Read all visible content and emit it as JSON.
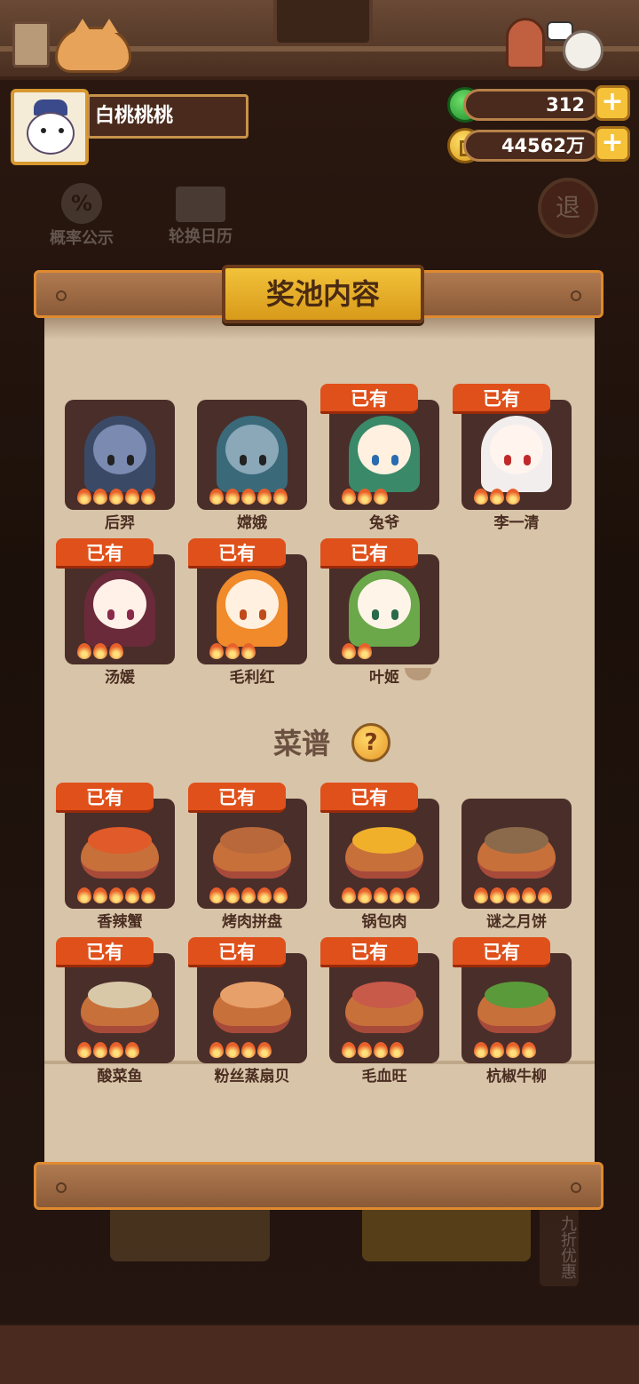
{
  "user": {
    "name": "白桃桃桃"
  },
  "currency": {
    "gems": "312",
    "coins": "44562万"
  },
  "bg_buttons": {
    "probability": "概率公示",
    "calendar": "轮换日历",
    "exit": "退",
    "discount": "九折优惠"
  },
  "panel": {
    "title": "奖池内容"
  },
  "characters": [
    {
      "name": "后羿",
      "owned": false,
      "stars": 5,
      "hair": "#3a4a66",
      "skin": "#7a8ab0",
      "eye": "#222"
    },
    {
      "name": "嫦娥",
      "owned": false,
      "stars": 5,
      "hair": "#3a6a7a",
      "skin": "#8aa8b8",
      "eye": "#222"
    },
    {
      "name": "兔爷",
      "owned": true,
      "stars": 3,
      "hair": "#3a8a6a",
      "skin": "#fff0e0",
      "eye": "#2a6ab0"
    },
    {
      "name": "李一清",
      "owned": true,
      "stars": 3,
      "hair": "#f2eeee",
      "skin": "#fff4ee",
      "eye": "#c02a2a"
    },
    {
      "name": "汤媛",
      "owned": true,
      "stars": 3,
      "hair": "#6a2a3a",
      "skin": "#fff0e8",
      "eye": "#8a2a4a"
    },
    {
      "name": "毛利红",
      "owned": true,
      "stars": 3,
      "hair": "#f08a2a",
      "skin": "#fff0e0",
      "eye": "#c04a1a"
    },
    {
      "name": "叶姬",
      "owned": true,
      "stars": 2,
      "hair": "#6aa84a",
      "skin": "#fff4e8",
      "eye": "#2a6a4a"
    }
  ],
  "recipes_section": {
    "title": "菜谱"
  },
  "recipes": [
    {
      "name": "香辣蟹",
      "owned": true,
      "stars": 5,
      "color": "#e05a2a"
    },
    {
      "name": "烤肉拼盘",
      "owned": true,
      "stars": 5,
      "color": "#b8683a"
    },
    {
      "name": "锅包肉",
      "owned": true,
      "stars": 5,
      "color": "#f0b02a"
    },
    {
      "name": "谜之月饼",
      "owned": false,
      "stars": 5,
      "color": "#8a6a4a"
    },
    {
      "name": "酸菜鱼",
      "owned": true,
      "stars": 4,
      "color": "#d8c8a8"
    },
    {
      "name": "粉丝蒸扇贝",
      "owned": true,
      "stars": 4,
      "color": "#e8a06a"
    },
    {
      "name": "毛血旺",
      "owned": true,
      "stars": 4,
      "color": "#c85a4a"
    },
    {
      "name": "杭椒牛柳",
      "owned": true,
      "stars": 4,
      "color": "#5a9a3a"
    }
  ],
  "labels": {
    "owned_badge": "已有"
  },
  "colors": {
    "accent": "#e0501a",
    "gold": "#f2c23a",
    "paper": "#d8c4a8",
    "card": "#4a2e2a"
  }
}
